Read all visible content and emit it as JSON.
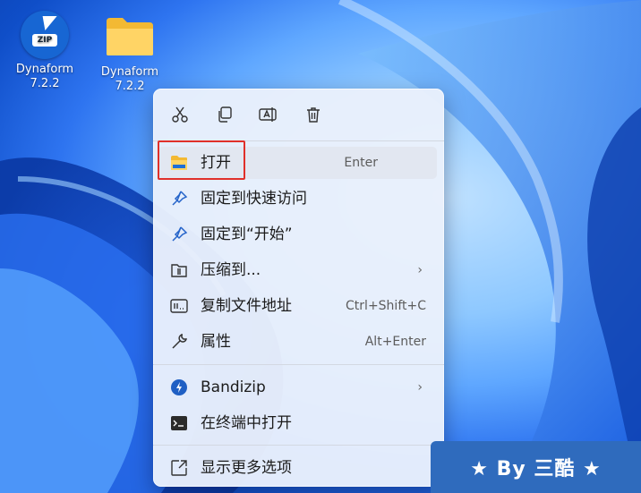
{
  "desktop": {
    "icons": [
      {
        "label_line1": "Dynaform",
        "label_line2": "7.2.2",
        "type": "zip-archive-icon",
        "badge": "ZIP"
      },
      {
        "label_line1": "Dynaform",
        "label_line2": "7.2.2",
        "type": "folder-icon"
      }
    ]
  },
  "menu": {
    "toolbar": [
      {
        "name": "cut-icon"
      },
      {
        "name": "copy-icon"
      },
      {
        "name": "rename-icon"
      },
      {
        "name": "delete-icon"
      }
    ],
    "items": [
      {
        "label": "打开",
        "shortcut": "Enter",
        "icon": "folder-icon"
      },
      {
        "label": "固定到快速访问",
        "shortcut": "",
        "icon": "pin-icon"
      },
      {
        "label": "固定到“开始”",
        "shortcut": "",
        "icon": "pin-icon"
      },
      {
        "label": "压缩到...",
        "shortcut": "",
        "icon": "zip-folder-icon",
        "submenu": true
      },
      {
        "label": "复制文件地址",
        "shortcut": "Ctrl+Shift+C",
        "icon": "copy-path-icon"
      },
      {
        "label": "属性",
        "shortcut": "Alt+Enter",
        "icon": "wrench-icon"
      },
      {
        "label": "Bandizip",
        "shortcut": "",
        "icon": "bandizip-icon",
        "submenu": true
      },
      {
        "label": "在终端中打开",
        "shortcut": "",
        "icon": "terminal-icon"
      },
      {
        "label": "显示更多选项",
        "shortcut": "",
        "icon": "more-options-icon"
      }
    ],
    "submenu_glyph": "›"
  },
  "watermark": {
    "text": "★ By 三酷 ★"
  },
  "colors": {
    "highlight_box": "#e0302a",
    "watermark_bg": "#2f6bbd",
    "menu_bg": "#eaf0fc"
  }
}
